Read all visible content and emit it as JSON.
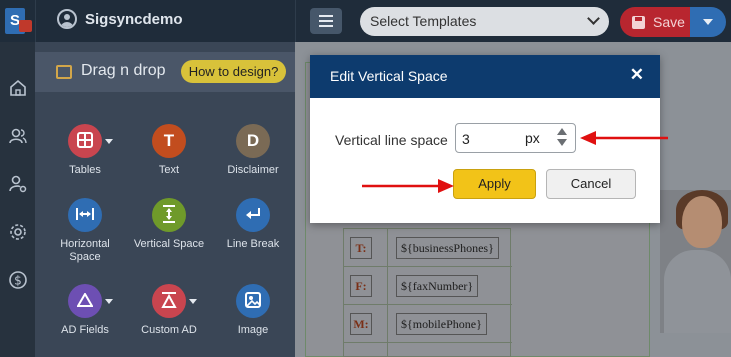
{
  "header": {
    "username": "Sigsyncdemo",
    "template_select": "Select Templates",
    "save_label": "Save"
  },
  "panel": {
    "title": "Drag n drop",
    "how_to_label": "How to design?",
    "tools": [
      {
        "label": "Tables",
        "glyph": "",
        "color": "#c9454f",
        "has_menu": true
      },
      {
        "label": "Text",
        "glyph": "T",
        "color": "#c24d1e",
        "has_menu": false
      },
      {
        "label": "Disclaimer",
        "glyph": "D",
        "color": "#7a6a55",
        "has_menu": false
      },
      {
        "label": "Horizontal Space",
        "glyph": "",
        "color": "#2f6db3",
        "has_menu": false
      },
      {
        "label": "Vertical Space",
        "glyph": "",
        "color": "#6f9a2a",
        "has_menu": false
      },
      {
        "label": "Line Break",
        "glyph": "",
        "color": "#2f6db3",
        "has_menu": false
      },
      {
        "label": "AD Fields",
        "glyph": "",
        "color": "#6d4fb3",
        "has_menu": true
      },
      {
        "label": "Custom AD",
        "glyph": "",
        "color": "#c9454f",
        "has_menu": true
      },
      {
        "label": "Image",
        "glyph": "",
        "color": "#2f6db3",
        "has_menu": false
      }
    ]
  },
  "signature": {
    "rows": [
      {
        "key": "T:",
        "value": "${businessPhones}"
      },
      {
        "key": "F:",
        "value": "${faxNumber}"
      },
      {
        "key": "M:",
        "value": "${mobilePhone}"
      }
    ]
  },
  "modal": {
    "title": "Edit Vertical Space",
    "close_symbol": "✕",
    "field_label": "Vertical line space",
    "field_value": "3",
    "field_unit": "px",
    "apply_label": "Apply",
    "cancel_label": "Cancel"
  },
  "colors": {
    "accent": "#0d3b6e",
    "apply": "#f2c318",
    "arrow": "#e01010"
  }
}
